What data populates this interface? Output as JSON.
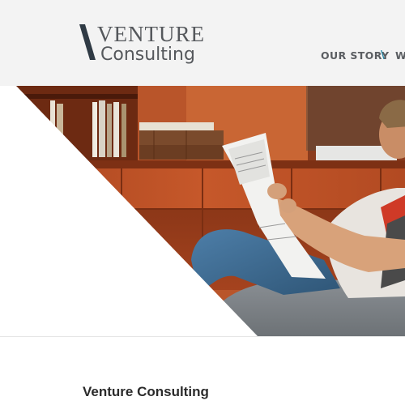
{
  "brand": {
    "name_line1": "VENTURE",
    "name_line2": "Consulting",
    "accent_color": "#2b8aa6",
    "text_color": "#55585c"
  },
  "nav": {
    "items": [
      {
        "label": "OUR STORY"
      },
      {
        "label": "W"
      }
    ],
    "separator": "\\"
  },
  "hero": {
    "image_description_icon": "man-reading-newspaper-photo"
  },
  "content": {
    "title": "Venture Consulting"
  }
}
